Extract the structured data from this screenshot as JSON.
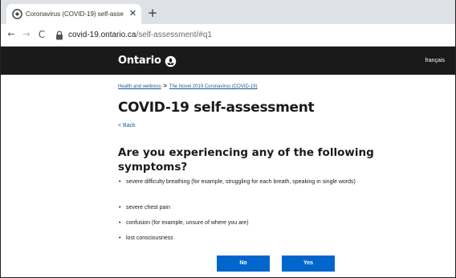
{
  "browser": {
    "tab": {
      "title": "Coronavirus (COVID-19) self-asse",
      "close_glyph": "✕"
    },
    "new_tab_glyph": "+",
    "nav": {
      "back": "←",
      "forward": "→",
      "reload": "C"
    },
    "url": {
      "host": "covid-19.ontario.ca",
      "path": "/self-assessment/#q1"
    }
  },
  "header": {
    "logo_text": "Ontario",
    "language_link": "français"
  },
  "breadcrumb": {
    "items": [
      "Health and wellness",
      "The Novel 2019 Coronavirus (COVID-19)"
    ],
    "separator": ">"
  },
  "page": {
    "title": "COVID-19 self-assessment",
    "back_link": "< Back",
    "question": "Are you experiencing any of the following symptoms?",
    "symptoms": [
      "severe difficulty breathing (for example, struggling for each breath, speaking in single words)",
      "severe chest pain",
      "confusion (for example, unsure of where you are)",
      "lost consciousness"
    ]
  },
  "buttons": {
    "no": "No",
    "yes": "Yes"
  },
  "colors": {
    "header_bg": "#1a1a1a",
    "button_bg": "#0066cc",
    "link": "#1a5a96"
  },
  "icons": [
    "favicon-icon",
    "close-icon",
    "plus-icon",
    "back-arrow-icon",
    "forward-arrow-icon",
    "reload-icon",
    "lock-icon",
    "trillium-logo-icon"
  ]
}
